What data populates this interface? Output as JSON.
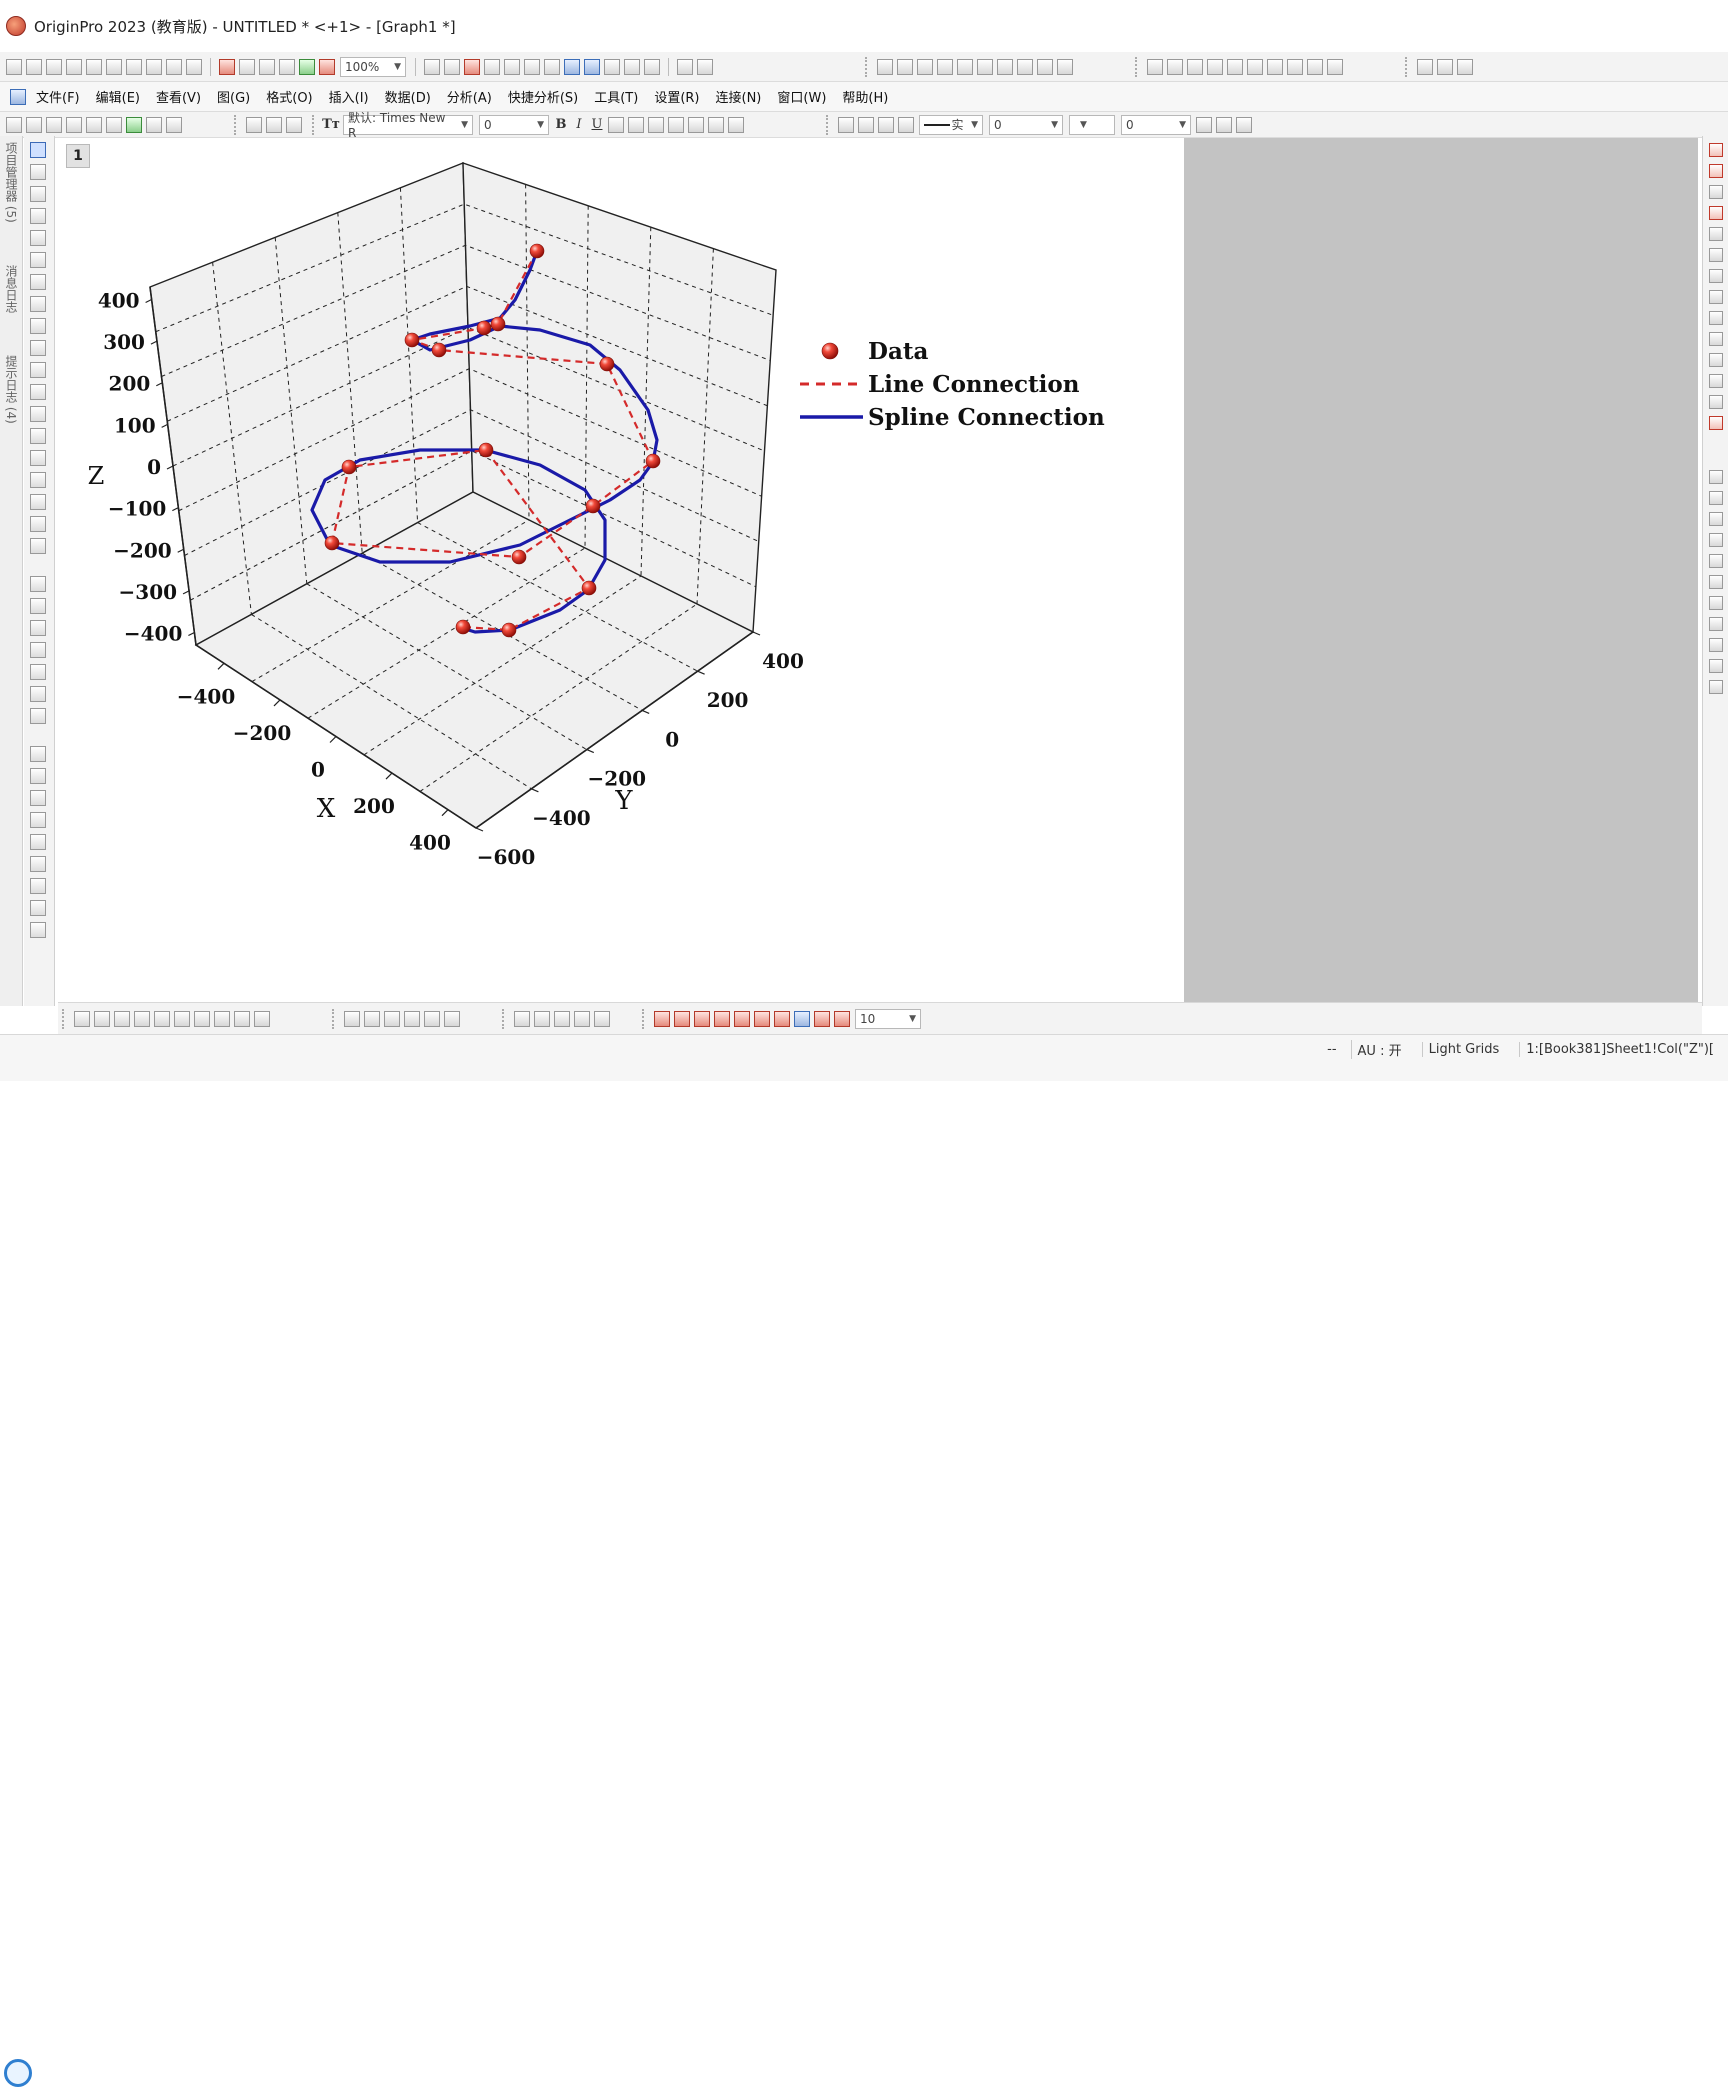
{
  "window": {
    "title": "OriginPro 2023 (教育版) - UNTITLED * <+1> - [Graph1 *]"
  },
  "toolbar_standard": {
    "zoom_value": "100%"
  },
  "menu": {
    "items": [
      "文件(F)",
      "编辑(E)",
      "查看(V)",
      "图(G)",
      "格式(O)",
      "插入(I)",
      "数据(D)",
      "分析(A)",
      "快捷分析(S)",
      "工具(T)",
      "设置(R)",
      "连接(N)",
      "窗口(W)",
      "帮助(H)"
    ]
  },
  "format_toolbar": {
    "font": "默认: Times New R",
    "font_size": "0",
    "bold": "B",
    "italic": "I",
    "underline": "U",
    "line_style": "实",
    "line_width": "0",
    "fill_width": "0"
  },
  "left_dock": {
    "tabs": [
      "项目管理器 (5)",
      "消息日志",
      "提示日志 (4)"
    ]
  },
  "graph": {
    "layer_number": "1",
    "legend": [
      "Data",
      "Line Connection",
      "Spline Connection"
    ],
    "colors": {
      "data": "#e02020",
      "line": "#d42a2a",
      "spline": "#1a1aa8"
    }
  },
  "bottom_toolbar": {
    "symbol_size": "10"
  },
  "status_bar": {
    "dashes": "--",
    "au": "AU : 开",
    "theme": "Light Grids",
    "active": "1:[Book381]Sheet1!Col(\"Z\")["
  },
  "chart_data": {
    "type": "scatter",
    "subtype": "3d-helix",
    "xlabel": "X",
    "ylabel": "Y",
    "zlabel": "Z",
    "x_ticks": [
      "−400",
      "−200",
      "0",
      "200",
      "400"
    ],
    "y_ticks": [
      "−600",
      "−400",
      "−200",
      "0",
      "200",
      "400"
    ],
    "z_ticks": [
      "400",
      "300",
      "200",
      "100",
      "0",
      "−100",
      "−200",
      "−300",
      "−400"
    ],
    "xlim": [
      -500,
      500
    ],
    "ylim": [
      -600,
      500
    ],
    "zlim": [
      -450,
      450
    ],
    "grid": true,
    "legend_position": "right",
    "series": [
      {
        "name": "Data",
        "marker": "sphere"
      },
      {
        "name": "Line Connection",
        "style": "dashed"
      },
      {
        "name": "Spline Connection",
        "style": "solid"
      }
    ],
    "points_z": [
      400,
      380,
      340,
      290,
      250,
      200,
      100,
      0,
      -100,
      -150,
      -200,
      -250,
      -300,
      -350,
      -380,
      -400,
      -420
    ]
  }
}
